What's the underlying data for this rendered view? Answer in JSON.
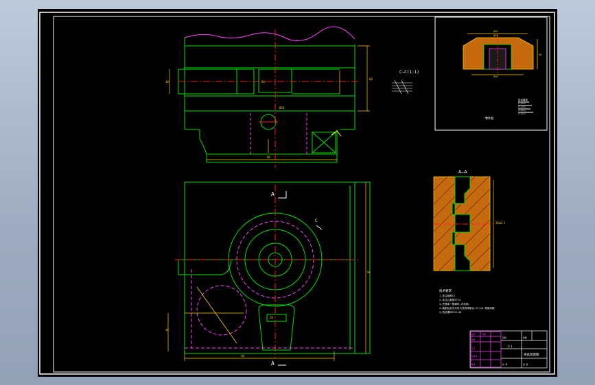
{
  "section_labels": {
    "c_c": "C—C(1:1)",
    "a_a": "A—A",
    "a_top": "A",
    "a_bottom": "A",
    "c_arrow": "C"
  },
  "dimensions": {
    "hole_dia": "Ø20",
    "top_width": "80",
    "side_height": "60",
    "bottom_width": "20",
    "left_dim": "40",
    "aa_height": "30±0.1",
    "front_dim_1": "40",
    "front_dim_2": "90",
    "front_dim_3": "20",
    "front_dim_4": "40",
    "inset_top_1": "Ø36",
    "inset_top_2": "Ø28",
    "inset_side": "50",
    "inset_bottom": "Ø48"
  },
  "inset_caption": "零件图",
  "tech_requirements": {
    "title": "技术要求",
    "lines": [
      "1.未注倒角C1",
      "2.未注公差按IT14",
      "3.夹具体一般铸件,去毛刺。",
      "4.装配后定位元件与夹具体配合,H7/n6,表面渗碳",
      "5.热处理HRC55-60"
    ]
  },
  "inset_notes": [
    "技术要求",
    "1.xxxx",
    "2.xxxx",
    "3.xxxx",
    "4.xxxx"
  ],
  "title_block": {
    "scale": "1:1",
    "drawing_name": "夹具装配图",
    "cells": [
      "设计",
      "审核",
      "工艺",
      "标准化",
      "批准",
      "日期",
      "比例",
      "重量",
      "共 张",
      "第 张"
    ]
  }
}
